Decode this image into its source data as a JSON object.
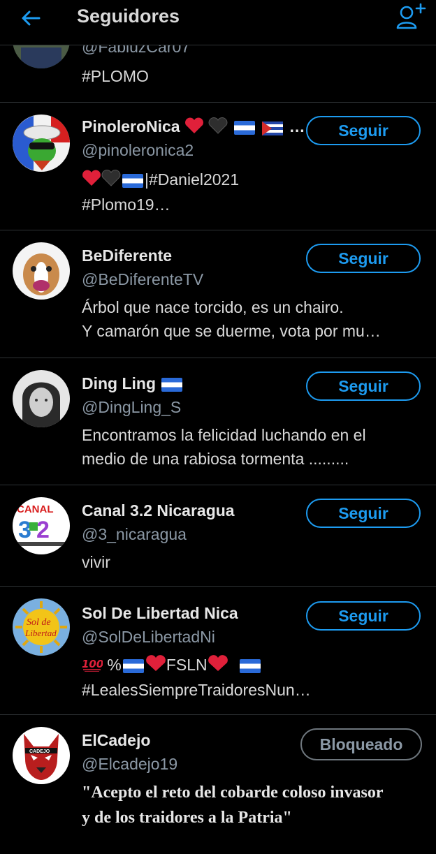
{
  "header": {
    "title": "Seguidores",
    "back_icon": "arrow-left-icon",
    "add_icon": "add-user-icon"
  },
  "colors": {
    "accent": "#1d9bf0",
    "background": "#000000",
    "secondary_text": "#8b98a5"
  },
  "partial": {
    "handle": "@FabiuzCar07",
    "bio": "#PLOMO"
  },
  "users": [
    {
      "name": "PinoleroNica",
      "name_suffix": "…",
      "handle": "@pinoleronica2",
      "bio_line1_text": "|#Daniel2021",
      "bio_line2": "#Plomo19…",
      "button": "Seguir"
    },
    {
      "name": "BeDiferente",
      "handle": "@BeDiferenteTV",
      "bio_line1": "Árbol que nace torcido, es un chairo.",
      "bio_line2": "Y camarón que se duerme, vota por mu…",
      "button": "Seguir"
    },
    {
      "name": "Ding Ling",
      "handle": "@DingLing_S",
      "bio_line1": "Encontramos la felicidad luchando en el",
      "bio_line2": "medio de una rabiosa tormenta .........",
      "button": "Seguir"
    },
    {
      "name": "Canal 3.2 Nicaragua",
      "handle": "@3_nicaragua",
      "bio_line1": "vivir",
      "button": "Seguir"
    },
    {
      "name": "Sol De Libertad Nica",
      "handle": "@SolDeLibertadNi",
      "bio_line1_a": "%",
      "bio_line1_b": "FSLN",
      "bio_line2": "#LealesSiempreTraidoresNun…",
      "button": "Seguir"
    },
    {
      "name": "ElCadejo",
      "handle": "@Elcadejo19",
      "bio_line1": "\"Acepto el reto del cobarde coloso invasor",
      "bio_line2": "y de los traidores a la Patria\"",
      "button": "Bloqueado"
    }
  ]
}
